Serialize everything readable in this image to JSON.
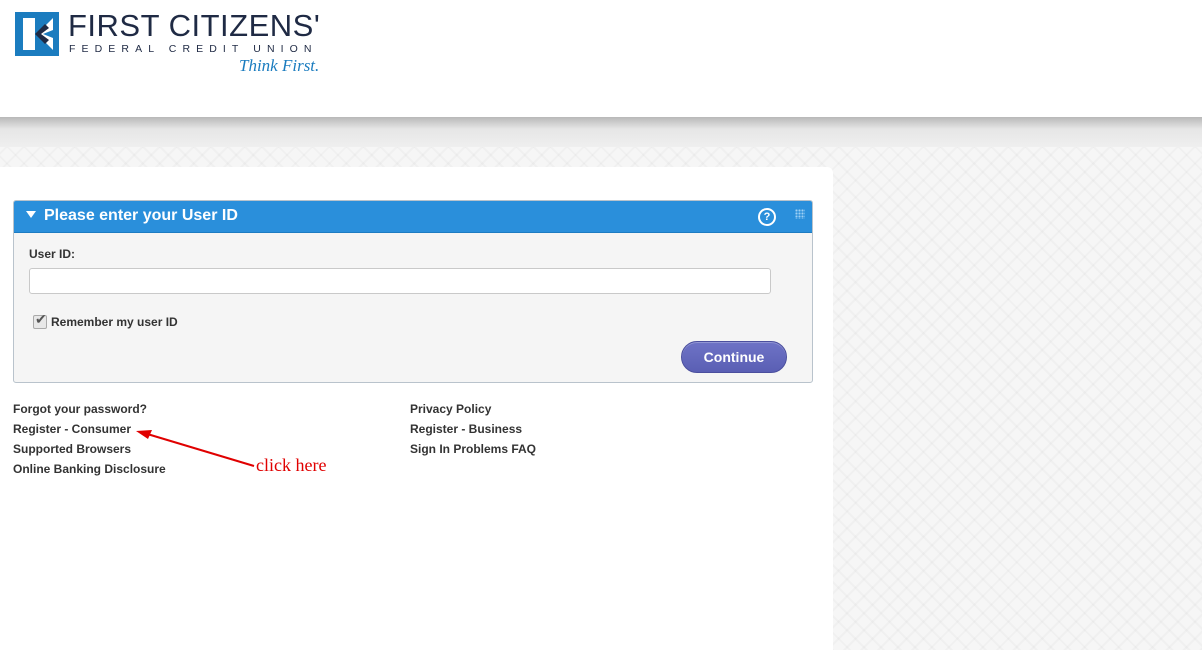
{
  "brand": {
    "name": "FIRST CITIZENS'",
    "subtitle": "FEDERAL CREDIT UNION",
    "tagline": "Think First."
  },
  "login_panel": {
    "title": "Please enter your User ID",
    "help_glyph": "?",
    "user_id_label": "User ID:",
    "user_id_value": "",
    "user_id_placeholder": "",
    "remember_label": "Remember my user ID",
    "remember_checked": true,
    "continue_label": "Continue"
  },
  "links": {
    "left": [
      "Forgot your password?",
      "Register - Consumer",
      "Supported Browsers",
      "Online Banking Disclosure"
    ],
    "right": [
      "Privacy Policy",
      "Register - Business",
      "Sign In Problems FAQ"
    ]
  },
  "annotation": {
    "text": "click here"
  },
  "colors": {
    "panel_header": "#2a8fdb",
    "continue_button": "#5f64b9",
    "brand_dark": "#1f2a44",
    "brand_blue": "#1b7cbf",
    "annotation_red": "#e00000"
  }
}
